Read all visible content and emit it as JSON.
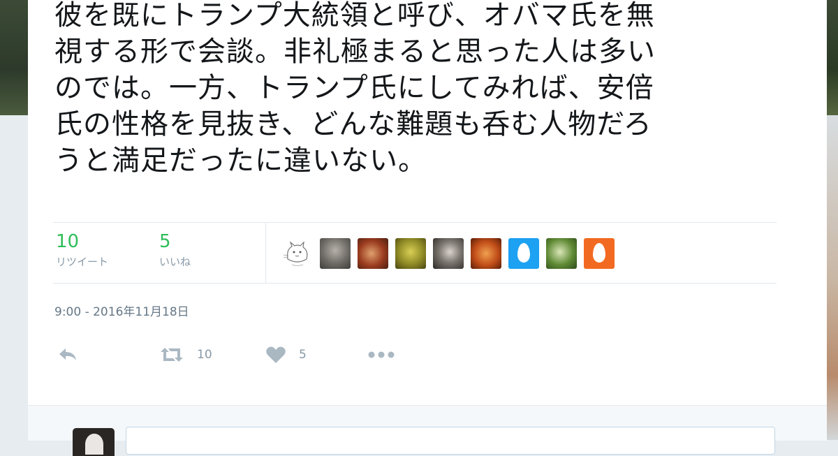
{
  "tweet": {
    "text_lines": [
      "彼を既にトランプ大統領と呼び、オバマ氏を無",
      "視する形で会談。非礼極まると思った人は多い",
      "のでは。一方、トランプ氏にしてみれば、安倍",
      "氏の性格を見抜き、どんな難題も呑む人物だろ",
      "うと満足だったに違いない。"
    ],
    "timestamp": "9:00 - 2016年11月18日"
  },
  "stats": {
    "retweets": {
      "count": "10",
      "label": "リツイート"
    },
    "likes": {
      "count": "5",
      "label": "いいね"
    }
  },
  "avatars": [
    {
      "name": "sketch-cat-avatar",
      "color": "#ffffff"
    },
    {
      "name": "photo-avatar-1",
      "color": "#6e6b66"
    },
    {
      "name": "photo-avatar-2",
      "color": "#9a3b1f"
    },
    {
      "name": "photo-avatar-3",
      "color": "#8f8a26"
    },
    {
      "name": "photo-avatar-4",
      "color": "#3a3633"
    },
    {
      "name": "photo-avatar-5",
      "color": "#c14d18"
    },
    {
      "name": "egg-avatar-blue",
      "color": "#1da1f2"
    },
    {
      "name": "photo-avatar-6",
      "color": "#5f8a34"
    },
    {
      "name": "egg-avatar-orange",
      "color": "#f26a21"
    }
  ],
  "actions": {
    "reply": {
      "icon": "reply-icon"
    },
    "retweet": {
      "icon": "retweet-icon",
      "count": "10"
    },
    "like": {
      "icon": "heart-icon",
      "count": "5"
    },
    "more": {
      "icon": "more-dots-icon"
    }
  },
  "colors": {
    "retweet_green": "#2ebd59",
    "muted_text": "#8899a6",
    "border": "#e1e8ed",
    "egg_blue": "#1da1f2",
    "egg_orange": "#f26a21"
  }
}
